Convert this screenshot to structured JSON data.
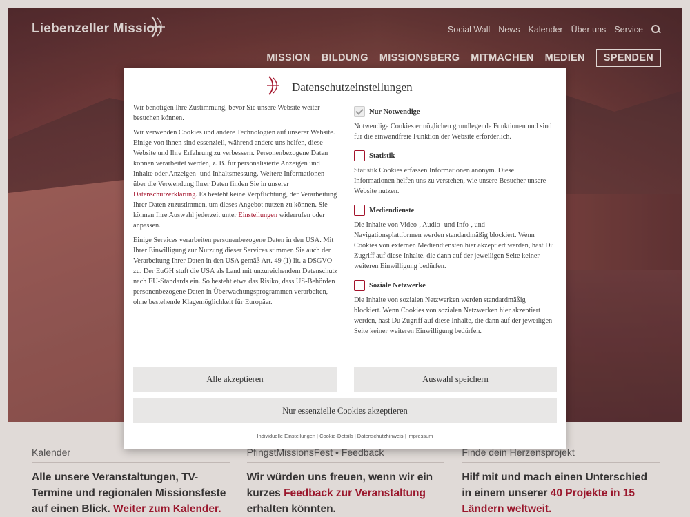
{
  "site": {
    "logo_text": "Liebenzeller Mission",
    "top_nav": [
      "Social Wall",
      "News",
      "Kalender",
      "Über uns",
      "Service"
    ],
    "main_nav": [
      "MISSION",
      "BILDUNG",
      "MISSIONSBERG",
      "MITMACHEN",
      "MEDIEN"
    ],
    "donate_label": "SPENDEN"
  },
  "teasers": [
    {
      "title": "Kalender",
      "text_pre": "Alle unsere Veranstaltungen, TV-Termine und regionalen Missionsfeste auf einen Blick. ",
      "link": "Weiter zum Kalender.",
      "text_post": ""
    },
    {
      "title": "PfingstMissionsFest • Feedback",
      "text_pre": "Wir würden uns freuen, wenn wir ein kurzes ",
      "link": "Feedback zur Veranstaltung",
      "text_post": " erhalten könnten."
    },
    {
      "title": "Finde dein Herzensprojekt",
      "text_pre": "Hilf mit und mach einen Unterschied in einem unserer ",
      "link": "40 Projekte in 15 Ländern weltweit.",
      "text_post": ""
    }
  ],
  "dialog": {
    "title": "Datenschutzeinstellungen",
    "intro": "Wir benötigen Ihre Zustimmung, bevor Sie unsere Website weiter besuchen können.",
    "p2_pre": "Wir verwenden Cookies und andere Technologien auf unserer Website. Einige von ihnen sind essenziell, während andere uns helfen, diese Website und Ihre Erfahrung zu verbessern. Personenbezogene Daten können verarbeitet werden, z. B. für personalisierte Anzeigen und Inhalte oder Anzeigen- und Inhaltsmessung. Weitere Informationen über die Verwendung Ihrer Daten finden Sie in unserer ",
    "p2_link1": "Datenschutzerklärung",
    "p2_mid": ". Es besteht keine Verpflichtung, der Verarbeitung Ihrer Daten zuzustimmen, um dieses Angebot nutzen zu können. Sie können Ihre Auswahl jederzeit unter ",
    "p2_link2": "Einstellungen",
    "p2_post": " widerrufen oder anpassen.",
    "p3": "Einige Services verarbeiten personenbezogene Daten in den USA. Mit Ihrer Einwilligung zur Nutzung dieser Services stimmen Sie auch der Verarbeitung Ihrer Daten in den USA gemäß Art. 49 (1) lit. a DSGVO zu. Der EuGH stuft die USA als Land mit unzureichendem Datenschutz nach EU-Standards ein. So besteht etwa das Risiko, dass US-Behörden personenbezogene Daten in Überwachungsprogrammen verarbeiten, ohne bestehende Klagemöglichkeit für Europäer.",
    "options": [
      {
        "label": "Nur Notwendige",
        "checked": true,
        "desc": "Notwendige Cookies ermöglichen grundlegende Funktionen und sind für die einwandfreie Funktion der Website erforderlich."
      },
      {
        "label": "Statistik",
        "checked": false,
        "desc": "Statistik Cookies erfassen Informationen anonym. Diese Informationen helfen uns zu verstehen, wie unsere Besucher unsere Website nutzen."
      },
      {
        "label": "Mediendienste",
        "checked": false,
        "desc": "Die Inhalte von Video-, Audio- und Info-, und Navigationsplattformen werden standardmäßig blockiert. Wenn Cookies von externen Mediendiensten hier akzeptiert werden, hast Du Zugriff auf diese Inhalte, die dann auf der jeweiligen Seite keiner weiteren Einwilligung bedürfen."
      },
      {
        "label": "Soziale Netzwerke",
        "checked": false,
        "desc": "Die Inhalte von sozialen Netzwerken werden standardmäßig blockiert. Wenn Cookies von sozialen Netzwerken hier akzeptiert werden, hast Du Zugriff auf diese Inhalte, die dann auf der jeweiligen Seite keiner weiteren Einwilligung bedürfen."
      }
    ],
    "btn_accept_all": "Alle akzeptieren",
    "btn_save": "Auswahl speichern",
    "btn_essential": "Nur essenzielle Cookies akzeptieren",
    "footer_links": [
      "Individuelle Einstellungen",
      "Cookie-Details",
      "Datenschutzhinweis",
      "Impressum"
    ]
  },
  "colors": {
    "accent": "#a3132b"
  }
}
